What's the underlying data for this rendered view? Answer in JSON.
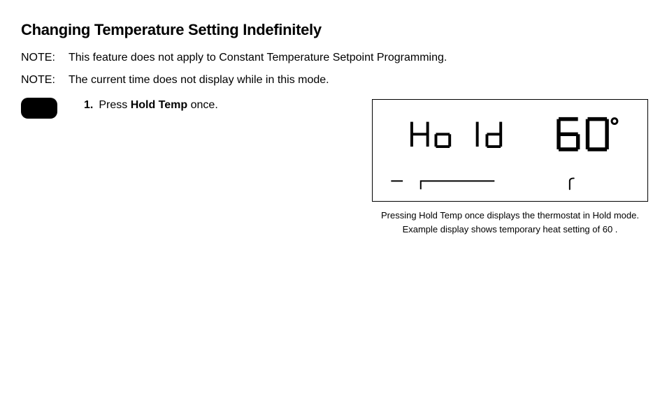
{
  "heading": "Changing Temperature Setting Indefinitely",
  "notes": [
    {
      "label": "NOTE:",
      "text": "This feature does not apply to Constant Temperature Setpoint Programming."
    },
    {
      "label": "NOTE:",
      "text": "The current time does not display while in this mode."
    }
  ],
  "step": {
    "num": "1.",
    "prefix": "Press ",
    "bold": "Hold Temp",
    "suffix": " once."
  },
  "display": {
    "hold_text": "Ho  ld",
    "temp_value": "60",
    "degree_symbol": "°"
  },
  "caption": {
    "line1": "Pressing Hold Temp once displays the thermostat in Hold mode.",
    "line2": "Example display shows temporary heat setting of 60 ."
  }
}
